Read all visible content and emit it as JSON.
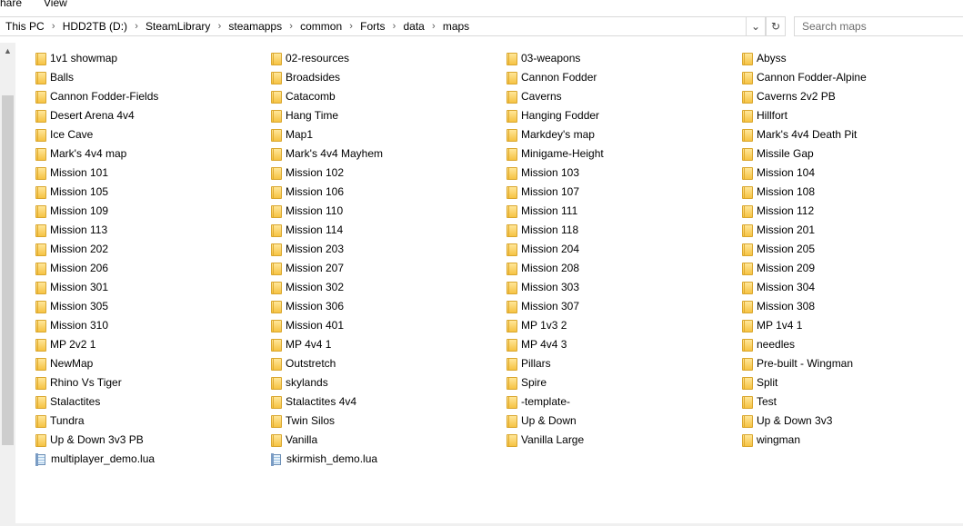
{
  "ribbon": {
    "tabs": [
      "Share",
      "View"
    ]
  },
  "address": {
    "crumbs": [
      "This PC",
      "HDD2TB (D:)",
      "SteamLibrary",
      "steamapps",
      "common",
      "Forts",
      "data",
      "maps"
    ]
  },
  "search": {
    "placeholder": "Search maps"
  },
  "icons": {
    "folder": "folder-icon",
    "file": "lua-file-icon",
    "separator": "chevron-right-icon",
    "dropdown": "chevron-down-icon",
    "refresh": "refresh-icon",
    "scroll_up": "scroll-up-arrow-icon"
  },
  "columns": [
    [
      {
        "name": "1v1 showmap",
        "type": "folder"
      },
      {
        "name": "Balls",
        "type": "folder"
      },
      {
        "name": "Cannon Fodder-Fields",
        "type": "folder"
      },
      {
        "name": "Desert Arena 4v4",
        "type": "folder"
      },
      {
        "name": "Ice Cave",
        "type": "folder"
      },
      {
        "name": "Mark's 4v4 map",
        "type": "folder"
      },
      {
        "name": "Mission 101",
        "type": "folder"
      },
      {
        "name": "Mission 105",
        "type": "folder"
      },
      {
        "name": "Mission 109",
        "type": "folder"
      },
      {
        "name": "Mission 113",
        "type": "folder"
      },
      {
        "name": "Mission 202",
        "type": "folder"
      },
      {
        "name": "Mission 206",
        "type": "folder"
      },
      {
        "name": "Mission 301",
        "type": "folder"
      },
      {
        "name": "Mission 305",
        "type": "folder"
      },
      {
        "name": "Mission 310",
        "type": "folder"
      },
      {
        "name": "MP 2v2 1",
        "type": "folder"
      },
      {
        "name": "NewMap",
        "type": "folder"
      },
      {
        "name": "Rhino Vs Tiger",
        "type": "folder"
      },
      {
        "name": "Stalactites",
        "type": "folder"
      },
      {
        "name": "Tundra",
        "type": "folder"
      },
      {
        "name": "Up & Down 3v3 PB",
        "type": "folder"
      },
      {
        "name": "multiplayer_demo.lua",
        "type": "file"
      }
    ],
    [
      {
        "name": "02-resources",
        "type": "folder"
      },
      {
        "name": "Broadsides",
        "type": "folder"
      },
      {
        "name": "Catacomb",
        "type": "folder"
      },
      {
        "name": "Hang Time",
        "type": "folder"
      },
      {
        "name": "Map1",
        "type": "folder"
      },
      {
        "name": "Mark's 4v4 Mayhem",
        "type": "folder"
      },
      {
        "name": "Mission 102",
        "type": "folder"
      },
      {
        "name": "Mission 106",
        "type": "folder"
      },
      {
        "name": "Mission 110",
        "type": "folder"
      },
      {
        "name": "Mission 114",
        "type": "folder"
      },
      {
        "name": "Mission 203",
        "type": "folder"
      },
      {
        "name": "Mission 207",
        "type": "folder"
      },
      {
        "name": "Mission 302",
        "type": "folder"
      },
      {
        "name": "Mission 306",
        "type": "folder"
      },
      {
        "name": "Mission 401",
        "type": "folder"
      },
      {
        "name": "MP 4v4 1",
        "type": "folder"
      },
      {
        "name": "Outstretch",
        "type": "folder"
      },
      {
        "name": "skylands",
        "type": "folder"
      },
      {
        "name": "Stalactites 4v4",
        "type": "folder"
      },
      {
        "name": "Twin Silos",
        "type": "folder"
      },
      {
        "name": "Vanilla",
        "type": "folder"
      },
      {
        "name": "skirmish_demo.lua",
        "type": "file"
      }
    ],
    [
      {
        "name": "03-weapons",
        "type": "folder"
      },
      {
        "name": "Cannon Fodder",
        "type": "folder"
      },
      {
        "name": "Caverns",
        "type": "folder"
      },
      {
        "name": "Hanging Fodder",
        "type": "folder"
      },
      {
        "name": "Markdey's map",
        "type": "folder"
      },
      {
        "name": "Minigame-Height",
        "type": "folder"
      },
      {
        "name": "Mission 103",
        "type": "folder"
      },
      {
        "name": "Mission 107",
        "type": "folder"
      },
      {
        "name": "Mission 111",
        "type": "folder"
      },
      {
        "name": "Mission 118",
        "type": "folder"
      },
      {
        "name": "Mission 204",
        "type": "folder"
      },
      {
        "name": "Mission 208",
        "type": "folder"
      },
      {
        "name": "Mission 303",
        "type": "folder"
      },
      {
        "name": "Mission 307",
        "type": "folder"
      },
      {
        "name": "MP 1v3 2",
        "type": "folder"
      },
      {
        "name": "MP 4v4 3",
        "type": "folder"
      },
      {
        "name": "Pillars",
        "type": "folder"
      },
      {
        "name": "Spire",
        "type": "folder"
      },
      {
        "name": "-template-",
        "type": "folder"
      },
      {
        "name": "Up & Down",
        "type": "folder"
      },
      {
        "name": "Vanilla Large",
        "type": "folder"
      }
    ],
    [
      {
        "name": "Abyss",
        "type": "folder"
      },
      {
        "name": "Cannon Fodder-Alpine",
        "type": "folder"
      },
      {
        "name": "Caverns 2v2 PB",
        "type": "folder"
      },
      {
        "name": "Hillfort",
        "type": "folder"
      },
      {
        "name": "Mark's 4v4 Death Pit",
        "type": "folder"
      },
      {
        "name": "Missile Gap",
        "type": "folder"
      },
      {
        "name": "Mission 104",
        "type": "folder"
      },
      {
        "name": "Mission 108",
        "type": "folder"
      },
      {
        "name": "Mission 112",
        "type": "folder"
      },
      {
        "name": "Mission 201",
        "type": "folder"
      },
      {
        "name": "Mission 205",
        "type": "folder"
      },
      {
        "name": "Mission 209",
        "type": "folder"
      },
      {
        "name": "Mission 304",
        "type": "folder"
      },
      {
        "name": "Mission 308",
        "type": "folder"
      },
      {
        "name": "MP 1v4 1",
        "type": "folder"
      },
      {
        "name": "needles",
        "type": "folder"
      },
      {
        "name": "Pre-built - Wingman",
        "type": "folder"
      },
      {
        "name": "Split",
        "type": "folder"
      },
      {
        "name": "Test",
        "type": "folder"
      },
      {
        "name": "Up & Down 3v3",
        "type": "folder"
      },
      {
        "name": "wingman",
        "type": "folder"
      }
    ]
  ]
}
